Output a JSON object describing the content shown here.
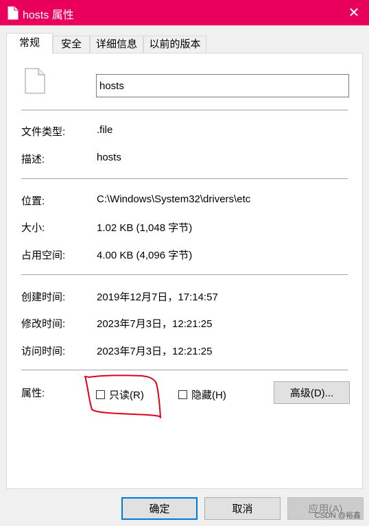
{
  "window": {
    "title": "hosts 属性",
    "close_symbol": "✕",
    "accent_color": "#e8005c"
  },
  "tabs": [
    {
      "label": "常规",
      "active": true
    },
    {
      "label": "安全",
      "active": false
    },
    {
      "label": "详细信息",
      "active": false
    },
    {
      "label": "以前的版本",
      "active": false
    }
  ],
  "general": {
    "file_name": "hosts",
    "file_type_label": "文件类型:",
    "file_type_value": ".file",
    "description_label": "描述:",
    "description_value": "hosts",
    "location_label": "位置:",
    "location_value": "C:\\Windows\\System32\\drivers\\etc",
    "size_label": "大小:",
    "size_value": "1.02 KB (1,048 字节)",
    "size_on_disk_label": "占用空间:",
    "size_on_disk_value": "4.00 KB (4,096 字节)",
    "created_label": "创建时间:",
    "created_value": "2019年12月7日，17:14:57",
    "modified_label": "修改时间:",
    "modified_value": "2023年7月3日，12:21:25",
    "accessed_label": "访问时间:",
    "accessed_value": "2023年7月3日，12:21:25",
    "attributes_label": "属性:",
    "readonly_label": "只读(R)",
    "readonly_checked": false,
    "hidden_label": "隐藏(H)",
    "hidden_checked": false,
    "advanced_button": "高级(D)..."
  },
  "footer": {
    "ok_button": "确定",
    "cancel_button": "取消",
    "apply_button": "应用(A)"
  },
  "watermark": "CSDN @裕鑫",
  "annotation_color": "#e0001b"
}
